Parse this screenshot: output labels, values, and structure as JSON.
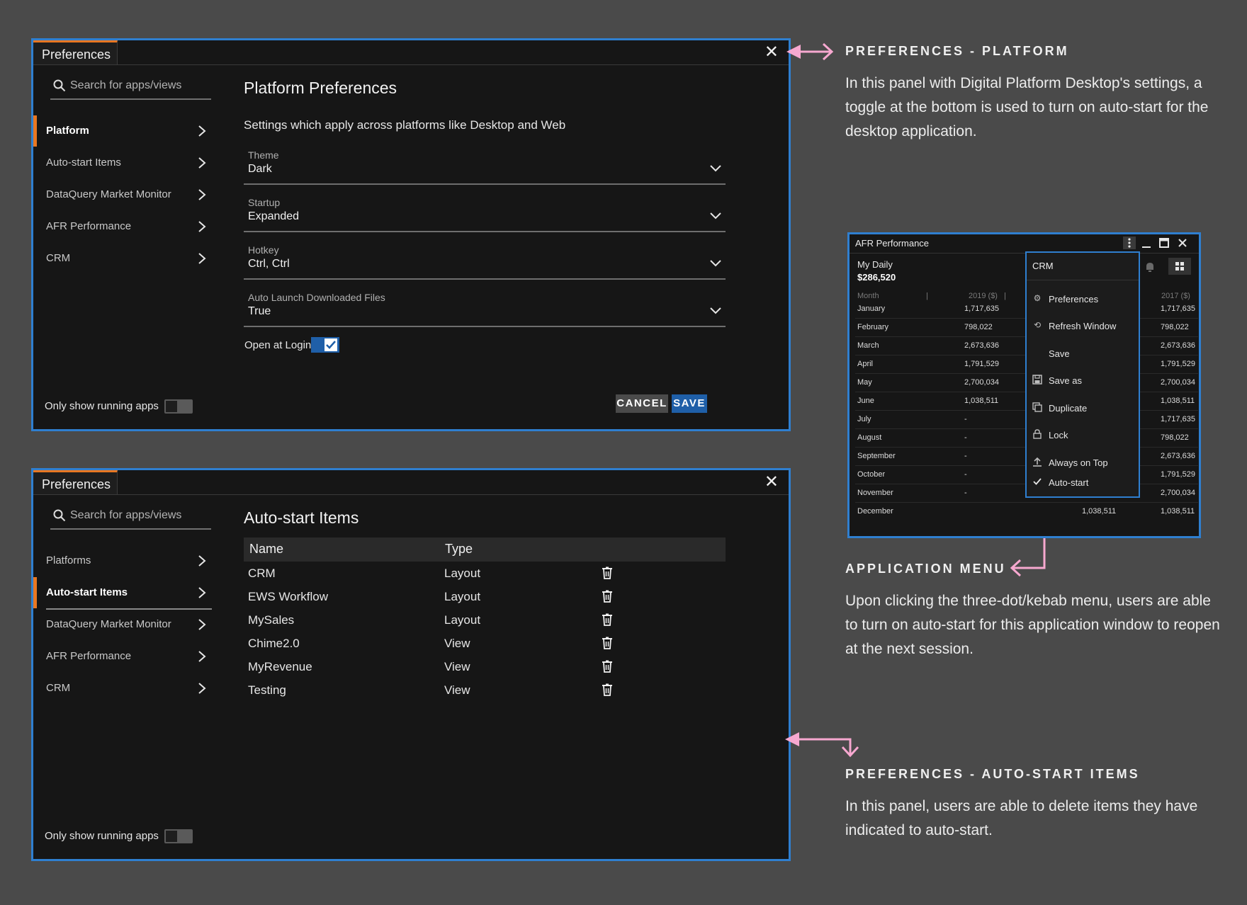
{
  "panel1": {
    "tab": "Preferences",
    "search_placeholder": "Search for apps/views",
    "nav": [
      "Platform",
      "Auto-start Items",
      "DataQuery Market Monitor",
      "AFR Performance",
      "CRM"
    ],
    "title": "Platform Preferences",
    "subtitle": "Settings which apply across platforms like Desktop and Web",
    "fields": [
      {
        "label": "Theme",
        "value": "Dark"
      },
      {
        "label": "Startup",
        "value": "Expanded"
      },
      {
        "label": "Hotkey",
        "value": "Ctrl, Ctrl"
      },
      {
        "label": "Auto Launch Downloaded Files",
        "value": "True"
      }
    ],
    "open_at_login": "Open at Login",
    "running_apps": "Only show running apps",
    "cancel": "CANCEL",
    "save": "SAVE"
  },
  "panel2": {
    "tab": "Preferences",
    "search_placeholder": "Search for apps/views",
    "nav": [
      "Platforms",
      "Auto-start Items",
      "DataQuery Market Monitor",
      "AFR Performance",
      "CRM"
    ],
    "title": "Auto-start Items",
    "col_name": "Name",
    "col_type": "Type",
    "rows": [
      {
        "name": "CRM",
        "type": "Layout"
      },
      {
        "name": "EWS Workflow",
        "type": "Layout"
      },
      {
        "name": "MySales",
        "type": "Layout"
      },
      {
        "name": "Chime2.0",
        "type": "View"
      },
      {
        "name": "MyRevenue",
        "type": "View"
      },
      {
        "name": "Testing",
        "type": "View"
      }
    ],
    "running_apps": "Only show running apps"
  },
  "annotations": {
    "a1_title": "PREFERENCES - PLATFORM",
    "a1_body": "In this panel with Digital Platform Desktop's settings, a toggle at the bottom is used to turn on auto-start for the desktop application.",
    "a2_title": "APPLICATION MENU",
    "a2_body": "Upon clicking the three-dot/kebab menu, users are able to turn on auto-start for this application window to reopen at the next session.",
    "a3_title": "PREFERENCES - AUTO-START ITEMS",
    "a3_body": "In this panel, users are able to delete items they have indicated to auto-start."
  },
  "app": {
    "title": "AFR Performance",
    "header_a": "My Daily",
    "header_b": "$286,520",
    "col_month": "Month",
    "col_2019": "2019 ($)",
    "col_2017": "2017 ($)",
    "rows": [
      {
        "m": "January",
        "a": "1,717,635",
        "c": "1,717,635"
      },
      {
        "m": "February",
        "a": "798,022",
        "c": "798,022"
      },
      {
        "m": "March",
        "a": "2,673,636",
        "c": "2,673,636"
      },
      {
        "m": "April",
        "a": "1,791,529",
        "c": "1,791,529"
      },
      {
        "m": "May",
        "a": "2,700,034",
        "c": "2,700,034"
      },
      {
        "m": "June",
        "a": "1,038,511",
        "c": "1,038,511"
      },
      {
        "m": "July",
        "a": "-",
        "c": "1,717,635"
      },
      {
        "m": "August",
        "a": "-",
        "c": "798,022"
      },
      {
        "m": "September",
        "a": "-",
        "c": "2,673,636"
      },
      {
        "m": "October",
        "a": "-",
        "c": "1,791,529"
      },
      {
        "m": "November",
        "a": "-",
        "c": "2,700,034"
      },
      {
        "m": "December",
        "a": "1,038,511",
        "c": "1,038,511"
      }
    ],
    "menu_title": "CRM",
    "menu": [
      {
        "label": "Preferences",
        "icon": "gear-icon"
      },
      {
        "label": "Refresh Window",
        "icon": "refresh-icon"
      },
      {
        "label": "Save",
        "icon": ""
      },
      {
        "label": "Save as",
        "icon": "save-icon"
      },
      {
        "label": "Duplicate",
        "icon": "duplicate-icon"
      },
      {
        "label": "Lock",
        "icon": "lock-icon"
      },
      {
        "label": "Always on Top",
        "icon": "upload-icon"
      },
      {
        "label": "Auto-start",
        "icon": "check-icon"
      }
    ]
  },
  "colors": {
    "accent": "#e87722",
    "frame": "#2f7fd0",
    "arrow": "#f7a8d0",
    "button_blue": "#1f5fa8"
  }
}
